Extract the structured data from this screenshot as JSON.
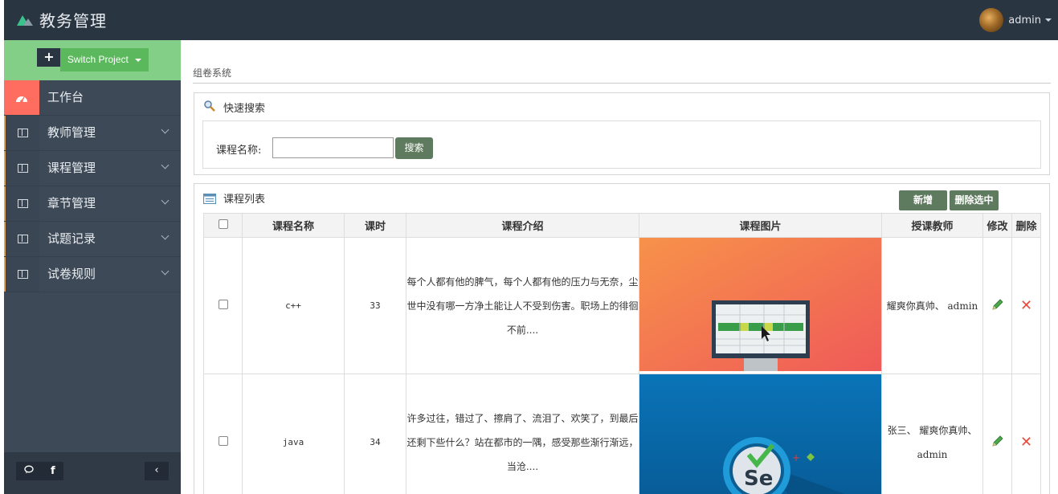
{
  "app": {
    "title": "教务管理"
  },
  "user": {
    "name": "admin"
  },
  "sidebar": {
    "switch_label": "Switch Project",
    "items": [
      {
        "label": "工作台",
        "icon": "dashboard-icon"
      },
      {
        "label": "教师管理",
        "icon": "window-icon"
      },
      {
        "label": "课程管理",
        "icon": "window-icon"
      },
      {
        "label": "章节管理",
        "icon": "window-icon"
      },
      {
        "label": "试题记录",
        "icon": "window-icon"
      },
      {
        "label": "试卷规则",
        "icon": "window-icon"
      }
    ],
    "footer": {
      "chat_icon": "chat-icon",
      "facebook_label": "f",
      "collapse_label": "‹"
    }
  },
  "breadcrumb": "组卷系统",
  "search_panel": {
    "title": "快速搜索",
    "label": "课程名称:",
    "input_value": "",
    "button_label": "搜索"
  },
  "list_panel": {
    "title": "课程列表",
    "add_label": "新增",
    "delete_selected_label": "删除选中",
    "columns": [
      "课程名称",
      "课时",
      "课程介绍",
      "课程图片",
      "授课教师",
      "修改",
      "删除"
    ],
    "rows": [
      {
        "name": "c++",
        "hours": "33",
        "intro": "每个人都有他的脾气，每个人都有他的压力与无奈，尘世中没有哪一方净土能让人不受到伤害。职场上的徘徊不前....",
        "image": "monitor-illustration",
        "teacher": "耀爽你真帅、 admin"
      },
      {
        "name": "java",
        "hours": "34",
        "intro": "许多过往，错过了、擦肩了、流泪了、欢笑了，到最后还剩下些什么？站在都市的一隅，感受那些渐行渐远，当沧....",
        "image": "selenium-illustration",
        "teacher": "张三、 耀爽你真帅、 admin"
      }
    ]
  }
}
